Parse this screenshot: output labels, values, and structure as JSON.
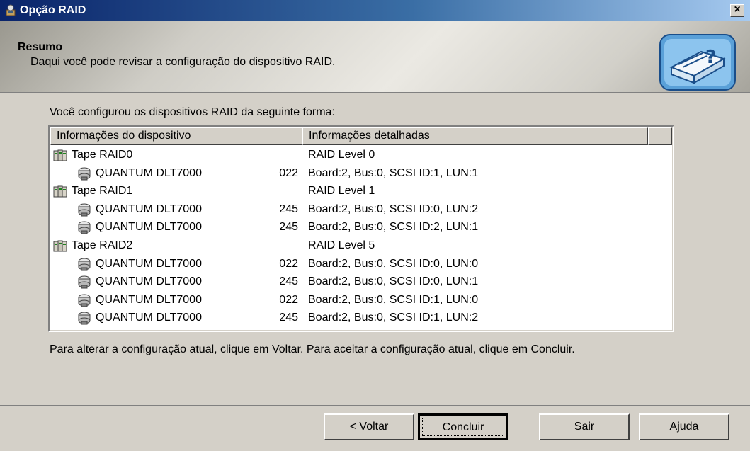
{
  "window": {
    "title": "Opção RAID",
    "close_label": "×"
  },
  "header": {
    "title": "Resumo",
    "subtitle": "Daqui você pode revisar a configuração do dispositivo RAID."
  },
  "intro": "Você configurou os dispositivos RAID da seguinte forma:",
  "list": {
    "columns": [
      "Informações do dispositivo",
      "Informações detalhadas"
    ],
    "rows": [
      {
        "name": "Tape RAID0",
        "num": "",
        "detail": "RAID Level  0",
        "kind": "raid"
      },
      {
        "name": "QUANTUM DLT7000",
        "num": "022",
        "detail": "Board:2, Bus:0, SCSI ID:1, LUN:1",
        "kind": "drive"
      },
      {
        "name": "Tape RAID1",
        "num": "",
        "detail": "RAID Level  1",
        "kind": "raid"
      },
      {
        "name": "QUANTUM DLT7000",
        "num": "245",
        "detail": "Board:2, Bus:0, SCSI ID:0, LUN:2",
        "kind": "drive"
      },
      {
        "name": "QUANTUM DLT7000",
        "num": "245",
        "detail": "Board:2, Bus:0, SCSI ID:2, LUN:1",
        "kind": "drive"
      },
      {
        "name": "Tape RAID2",
        "num": "",
        "detail": "RAID Level  5",
        "kind": "raid"
      },
      {
        "name": "QUANTUM DLT7000",
        "num": "022",
        "detail": "Board:2, Bus:0, SCSI ID:0, LUN:0",
        "kind": "drive"
      },
      {
        "name": "QUANTUM DLT7000",
        "num": "245",
        "detail": "Board:2, Bus:0, SCSI ID:0, LUN:1",
        "kind": "drive"
      },
      {
        "name": "QUANTUM DLT7000",
        "num": "022",
        "detail": "Board:2, Bus:0, SCSI ID:1, LUN:0",
        "kind": "drive"
      },
      {
        "name": "QUANTUM DLT7000",
        "num": "245",
        "detail": "Board:2, Bus:0, SCSI ID:1, LUN:2",
        "kind": "drive"
      }
    ]
  },
  "footer_text": "Para alterar a configuração atual, clique em Voltar. Para aceitar a configuração atual, clique em Concluir.",
  "buttons": {
    "back": "< Voltar",
    "finish": "Concluir",
    "exit": "Sair",
    "help": "Ajuda"
  }
}
